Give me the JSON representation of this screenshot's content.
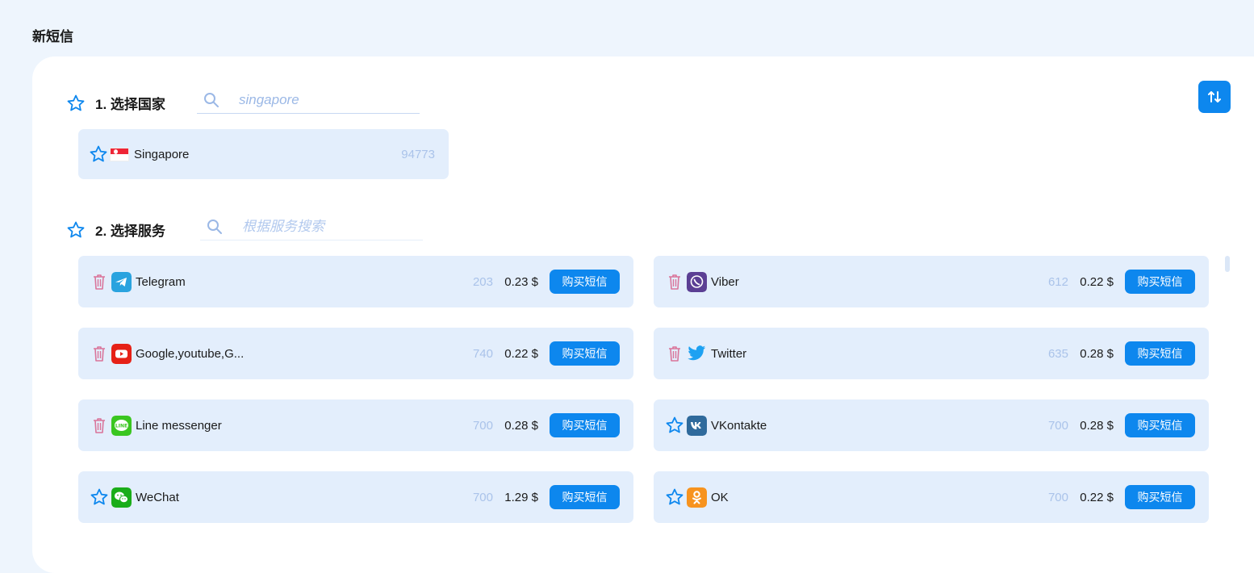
{
  "page": {
    "title": "新短信"
  },
  "country_section": {
    "title": "1. 选择国家",
    "search_value": "singapore",
    "search_placeholder": "",
    "country": {
      "name": "Singapore",
      "count": "94773"
    }
  },
  "service_section": {
    "title": "2. 选择服务",
    "search_placeholder": "根据服务搜索"
  },
  "services": [
    {
      "name": "Telegram",
      "count": "203",
      "price": "0.23 $",
      "action": "购买短信",
      "lead_icon": "trash-icon",
      "logo": "telegram-icon",
      "color": "#2aa3df"
    },
    {
      "name": "Viber",
      "count": "612",
      "price": "0.22 $",
      "action": "购买短信",
      "lead_icon": "trash-icon",
      "logo": "viber-icon",
      "color": "#665cac"
    },
    {
      "name": "Google,youtube,G...",
      "count": "740",
      "price": "0.22 $",
      "action": "购买短信",
      "lead_icon": "trash-icon",
      "logo": "youtube-icon",
      "color": "#e62117"
    },
    {
      "name": "Twitter",
      "count": "635",
      "price": "0.28 $",
      "action": "购买短信",
      "lead_icon": "trash-icon",
      "logo": "twitter-icon",
      "color": "#1da1f2"
    },
    {
      "name": "Line messenger",
      "count": "700",
      "price": "0.28 $",
      "action": "购买短信",
      "lead_icon": "trash-icon",
      "logo": "line-icon",
      "color": "#00c300"
    },
    {
      "name": "VKontakte",
      "count": "700",
      "price": "0.28 $",
      "action": "购买短信",
      "lead_icon": "star-icon",
      "logo": "vk-icon",
      "color": "#2f6a9c"
    },
    {
      "name": "WeChat",
      "count": "700",
      "price": "1.29 $",
      "action": "购买短信",
      "lead_icon": "star-icon",
      "logo": "wechat-icon",
      "color": "#1aad19"
    },
    {
      "name": "OK",
      "count": "700",
      "price": "0.22 $",
      "action": "购买短信",
      "lead_icon": "star-icon",
      "logo": "odnoklassniki-icon",
      "color": "#f7931e"
    }
  ],
  "colors": {
    "accent": "#0d87ee",
    "item_bg": "#e3eefc",
    "page_bg": "#eef5fd",
    "muted_count": "#aac3ea",
    "trash": "#d9749a"
  }
}
